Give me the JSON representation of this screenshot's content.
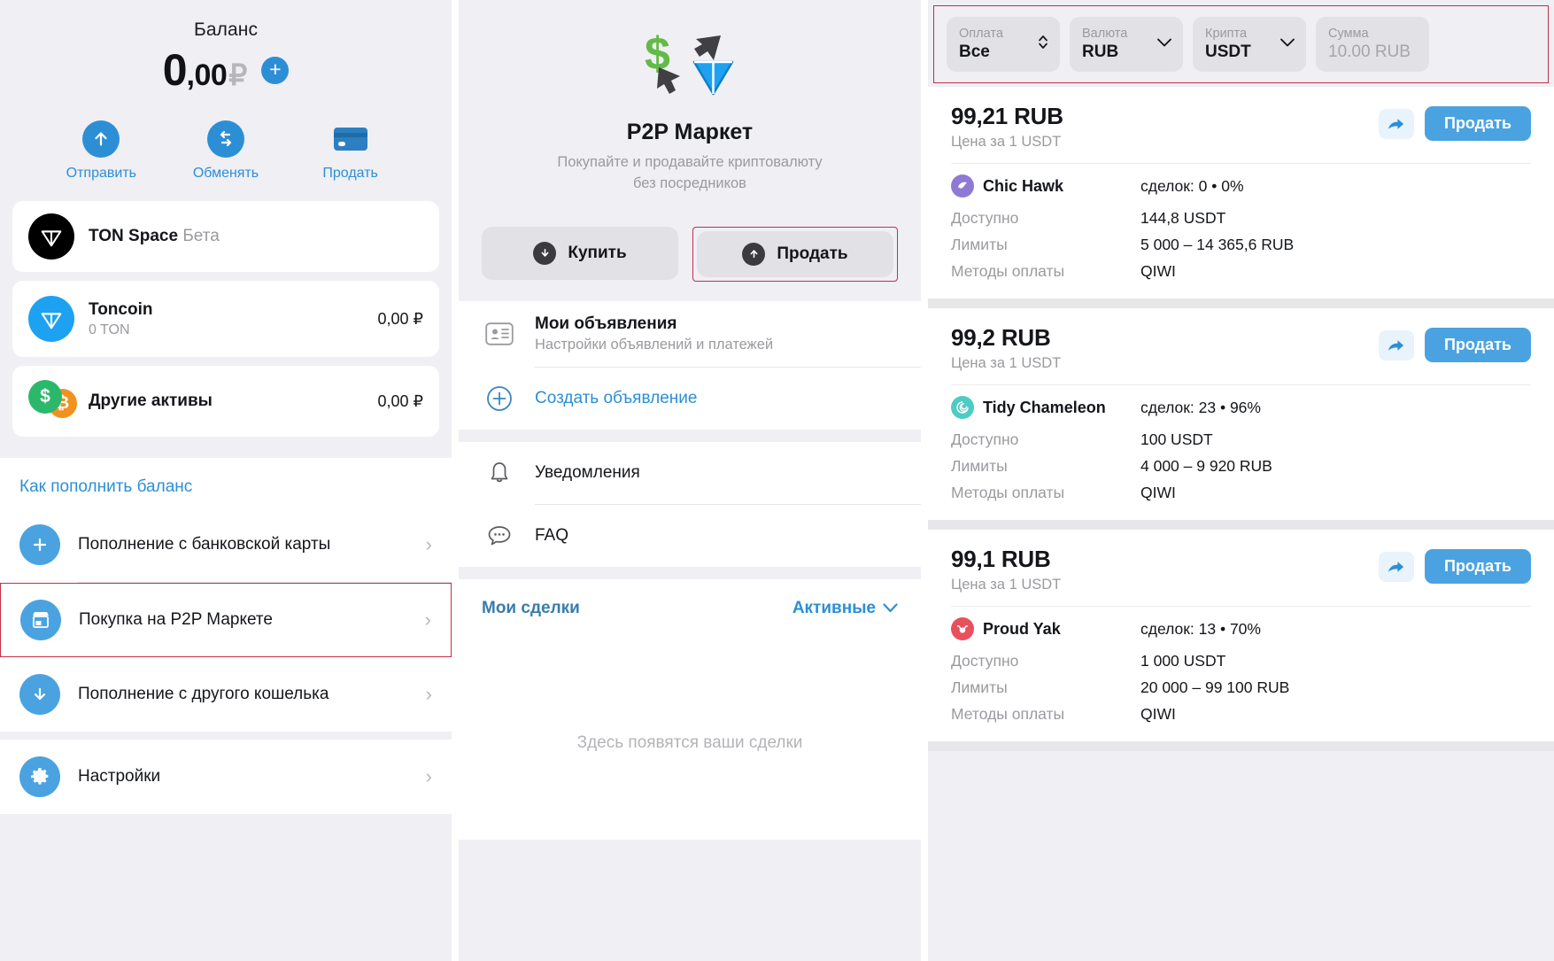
{
  "left": {
    "balance_label": "Баланс",
    "balance_int": "0",
    "balance_dec": ",00",
    "balance_currency": "₽",
    "add_icon": "plus-icon",
    "actions": [
      {
        "label": "Отправить",
        "icon": "arrow-up-icon"
      },
      {
        "label": "Обменять",
        "icon": "swap-icon"
      },
      {
        "label": "Продать",
        "icon": "card-icon"
      }
    ],
    "assets": [
      {
        "name": "TON Space",
        "badge": "Бета",
        "sub": "",
        "value": "",
        "icon": "ton-diamond-black-icon"
      },
      {
        "name": "Toncoin",
        "badge": "",
        "sub": "0 TON",
        "value": "0,00 ₽",
        "icon": "ton-diamond-blue-icon"
      },
      {
        "name": "Другие активы",
        "badge": "",
        "sub": "",
        "value": "0,00 ₽",
        "icon": "dual-coin-icon"
      }
    ],
    "replenish_head": "Как пополнить баланс",
    "replenish_rows": [
      {
        "label": "Пополнение с банковской карты",
        "icon": "plus-circle-icon",
        "highlighted": false
      },
      {
        "label": "Покупка на P2P Маркете",
        "icon": "storefront-icon",
        "highlighted": true
      },
      {
        "label": "Пополнение с другого кошелька",
        "icon": "arrow-down-circle-icon",
        "highlighted": false
      }
    ],
    "settings_row": {
      "label": "Настройки",
      "icon": "gear-icon"
    }
  },
  "middle": {
    "logo_icon": "p2p-market-logo",
    "title": "P2P Маркет",
    "subtitle_line1": "Покупайте и продавайте криптовалюту",
    "subtitle_line2": "без посредников",
    "buy_button": "Купить",
    "sell_button": "Продать",
    "menu": [
      {
        "title": "Мои объявления",
        "sub": "Настройки объявлений и платежей",
        "icon": "contact-card-icon",
        "link": false
      },
      {
        "title": "Создать объявление",
        "sub": "",
        "icon": "plus-circle-outline-icon",
        "link": true
      }
    ],
    "menu2": [
      {
        "title": "Уведомления",
        "icon": "bell-icon"
      },
      {
        "title": "FAQ",
        "icon": "chat-dots-icon"
      }
    ],
    "deals_title": "Мои сделки",
    "deals_filter": "Активные",
    "deals_filter_icon": "chevron-down-icon",
    "deals_empty": "Здесь появятся ваши сделки"
  },
  "right": {
    "filters": [
      {
        "label": "Оплата",
        "value": "Все",
        "icon": "updown-chevrons-icon",
        "placeholder": false
      },
      {
        "label": "Валюта",
        "value": "RUB",
        "icon": "chevron-down-icon",
        "placeholder": false
      },
      {
        "label": "Крипта",
        "value": "USDT",
        "icon": "chevron-down-icon",
        "placeholder": false
      },
      {
        "label": "Сумма",
        "value": "10.00 RUB",
        "icon": "",
        "placeholder": true
      }
    ],
    "labels": {
      "price_sub": "Цена за 1 USDT",
      "available": "Доступно",
      "limits": "Лимиты",
      "methods": "Методы оплаты",
      "sell_button": "Продать",
      "share_icon": "share-arrow-icon"
    },
    "offers": [
      {
        "price": "99,21 RUB",
        "merchant": "Chic Hawk",
        "merchant_icon": "hawk-avatar",
        "merchant_color": "#8e79d4",
        "stats": "сделок: 0 • 0%",
        "available": "144,8 USDT",
        "limits": "5 000 – 14 365,6 RUB",
        "methods": "QIWI"
      },
      {
        "price": "99,2 RUB",
        "merchant": "Tidy Chameleon",
        "merchant_icon": "chameleon-avatar",
        "merchant_color": "#4ecbc4",
        "stats": "сделок: 23 • 96%",
        "available": "100 USDT",
        "limits": "4 000 – 9 920 RUB",
        "methods": "QIWI"
      },
      {
        "price": "99,1 RUB",
        "merchant": "Proud Yak",
        "merchant_icon": "yak-avatar",
        "merchant_color": "#e8505b",
        "stats": "сделок: 13 • 70%",
        "available": "1 000 USDT",
        "limits": "20 000 – 99 100 RUB",
        "methods": "QIWI"
      }
    ]
  },
  "colors": {
    "accent": "#2c8fd6",
    "button": "#4aa3e0",
    "highlight": "#c0304a",
    "bg": "#efeff4"
  }
}
